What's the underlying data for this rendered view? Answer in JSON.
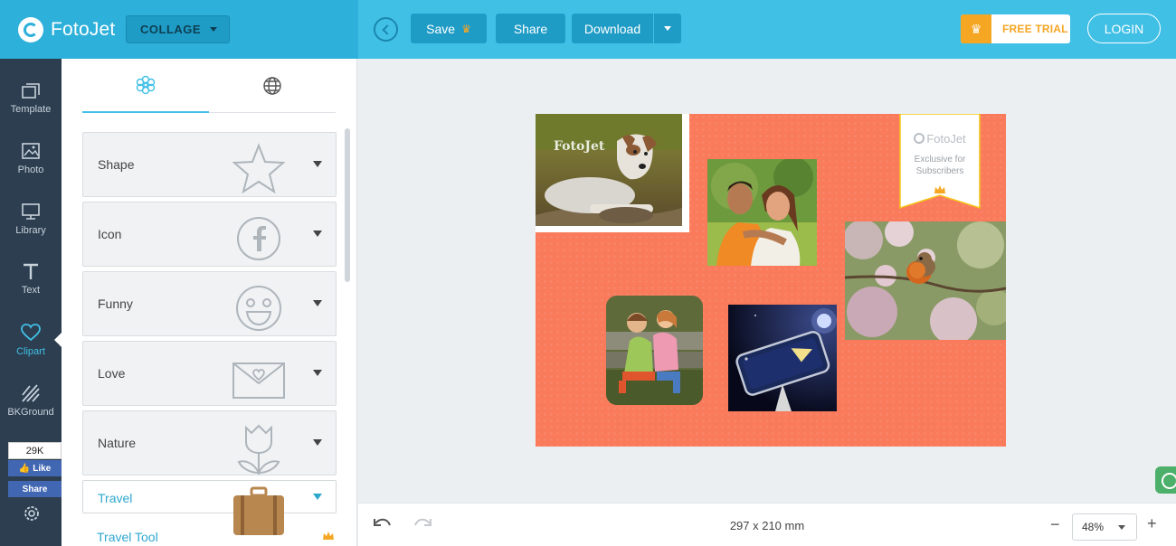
{
  "app": {
    "logo_text": "FotoJet",
    "mode": "COLLAGE"
  },
  "toolbar": {
    "save_label": "Save",
    "share_label": "Share",
    "download_label": "Download",
    "free_trial_label": "FREE TRIAL",
    "login_label": "LOGIN"
  },
  "nav": {
    "items": [
      {
        "label": "Template",
        "icon": "template-icon"
      },
      {
        "label": "Photo",
        "icon": "photo-icon"
      },
      {
        "label": "Library",
        "icon": "library-icon"
      },
      {
        "label": "Text",
        "icon": "text-icon"
      },
      {
        "label": "Clipart",
        "icon": "heart-icon",
        "active": true
      },
      {
        "label": "BKGround",
        "icon": "background-icon"
      }
    ],
    "facebook": {
      "count": "29K",
      "like_label": "Like",
      "share_label": "Share"
    }
  },
  "panel": {
    "tabs": [
      {
        "icon": "flower-icon",
        "active": true
      },
      {
        "icon": "globe-icon"
      }
    ],
    "categories": [
      {
        "label": "Shape",
        "icon": "star-icon"
      },
      {
        "label": "Icon",
        "icon": "facebook-icon"
      },
      {
        "label": "Funny",
        "icon": "smiley-icon"
      },
      {
        "label": "Love",
        "icon": "envelope-heart-icon"
      },
      {
        "label": "Nature",
        "icon": "tulip-icon"
      },
      {
        "label": "Travel",
        "icon": "suitcase-icon",
        "expanded": true
      }
    ],
    "sub_item": "Travel Tool"
  },
  "canvas": {
    "background_color": "#f97b5c",
    "badge": {
      "brand": "FotoJet",
      "text_line1": "Exclusive for",
      "text_line2": "Subscribers"
    },
    "watermark": "FotoJet"
  },
  "status": {
    "dimensions": "297 x 210 mm",
    "zoom": "48%"
  },
  "colors": {
    "header": "#41c0e6",
    "nav": "#2c3e50",
    "accent": "#f5a623"
  }
}
